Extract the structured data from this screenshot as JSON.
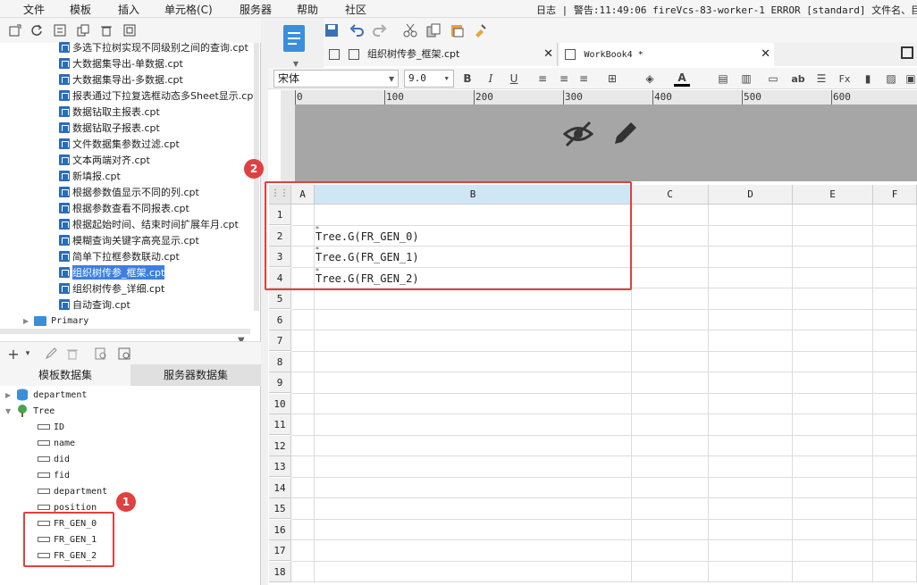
{
  "menu": [
    "文件",
    "模板",
    "插入",
    "单元格(C)",
    "服务器",
    "帮助",
    "社区"
  ],
  "log_text": "日志 | 警告:11:49:06 fireVcs-83-worker-1 ERROR [standard] 文件名、目录名",
  "file_tree": {
    "items": [
      "多选下拉树实现不同级别之间的查询.cpt",
      "大数据集导出-单数据.cpt",
      "大数据集导出-多数据.cpt",
      "报表通过下拉复选框动态多Sheet显示.cpt",
      "数据钻取主报表.cpt",
      "数据钻取子报表.cpt",
      "文件数据集参数过滤.cpt",
      "文本两端对齐.cpt",
      "新填报.cpt",
      "根据参数值显示不同的列.cpt",
      "根据参数查看不同报表.cpt",
      "根据起始时间、结束时间扩展年月.cpt",
      "模糊查询关键字高亮显示.cpt",
      "简单下拉框参数联动.cpt",
      "组织树传参_框架.cpt",
      "组织树传参_详细.cpt",
      "自动查询.cpt"
    ],
    "selected_index": 14,
    "folder": "Primary"
  },
  "dataset_tabs": [
    "模板数据集",
    "服务器数据集"
  ],
  "datasets": {
    "department": "department",
    "tree": "Tree",
    "fields": [
      "ID",
      "name",
      "did",
      "fid",
      "department",
      "position",
      "FR_GEN_0",
      "FR_GEN_1",
      "FR_GEN_2"
    ]
  },
  "doc_tabs": [
    "组织树传参_框架.cpt",
    "WorkBook4 *"
  ],
  "format": {
    "font": "宋体",
    "size": "9.0"
  },
  "ruler_marks": [
    "0",
    "100",
    "200",
    "300",
    "400",
    "500",
    "600"
  ],
  "columns": [
    "A",
    "B",
    "C",
    "D",
    "E",
    "F"
  ],
  "rows": [
    "1",
    "2",
    "3",
    "4",
    "5",
    "6",
    "7",
    "8",
    "9",
    "10",
    "11",
    "12",
    "13",
    "14",
    "15",
    "16",
    "17",
    "18"
  ],
  "cells": [
    "Tree.G(FR_GEN_0)",
    "Tree.G(FR_GEN_1)",
    "Tree.G(FR_GEN_2)"
  ],
  "badges": [
    "1",
    "2"
  ]
}
